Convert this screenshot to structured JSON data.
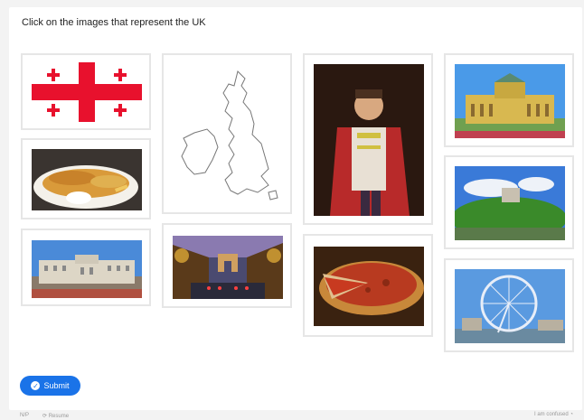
{
  "instruction": "Click on the images that represent the UK",
  "images": [
    {
      "id": "georgia-flag",
      "subject": "red cross flag with four small crosses"
    },
    {
      "id": "fish-and-chips",
      "subject": "fish and chips with dip"
    },
    {
      "id": "buckingham-palace",
      "subject": "palace facade under blue sky"
    },
    {
      "id": "uk-map",
      "subject": "outline map of the British Isles"
    },
    {
      "id": "arc-de-triomphe",
      "subject": "night street leading to arch"
    },
    {
      "id": "royal-portrait",
      "subject": "man in red ceremonial uniform"
    },
    {
      "id": "deep-dish-pizza",
      "subject": "deep dish pizza slice"
    },
    {
      "id": "opera-house",
      "subject": "ornate yellow building"
    },
    {
      "id": "castle-on-hill",
      "subject": "castle on wooded hill by water"
    },
    {
      "id": "london-eye",
      "subject": "ferris wheel by river"
    }
  ],
  "submit_label": "Submit",
  "footer": {
    "left": "N/P",
    "middle": "Resume",
    "right": "I am confused"
  },
  "colors": {
    "accent": "#1a73e8",
    "card_border": "#e6e6e6"
  }
}
